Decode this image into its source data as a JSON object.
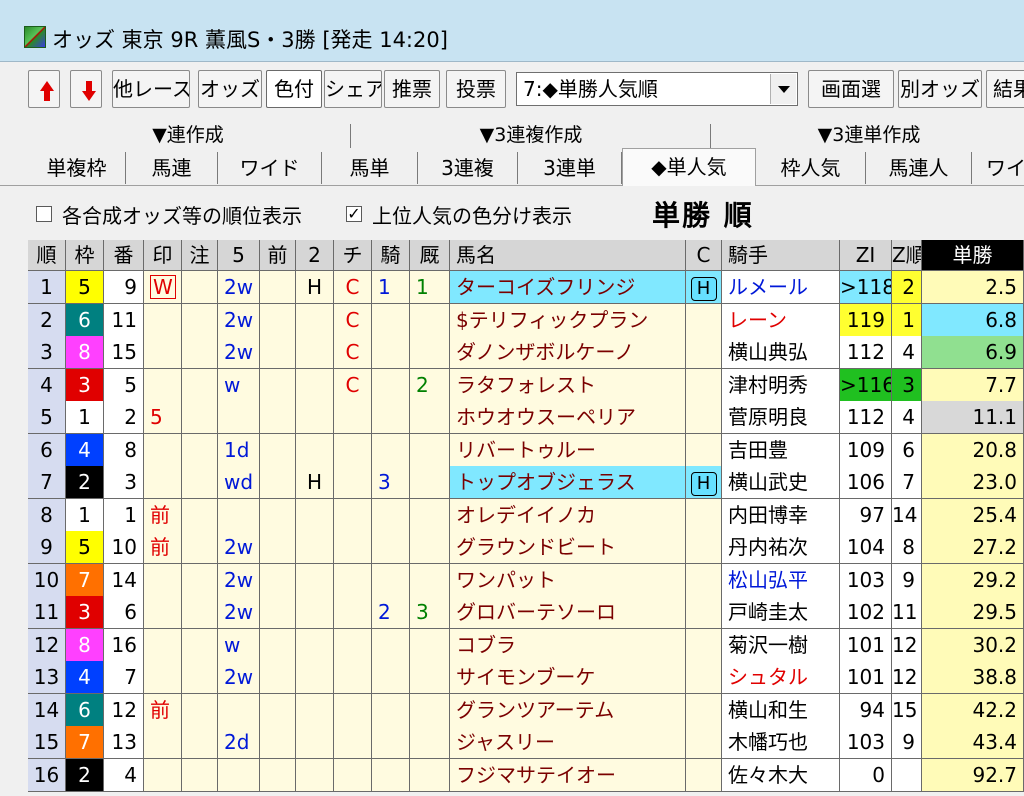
{
  "window": {
    "title": "オッズ 東京 9R 薫風S・3勝 [発走 14:20]"
  },
  "toolbar": {
    "other_race": "他レース",
    "odds": "オッズ",
    "color": "色付",
    "share": "シェア",
    "recommend": "推票",
    "vote": "投票",
    "view_select": "7:◆単勝人気順",
    "screen_select": "画面選",
    "other_odds": "別オッズ",
    "result": "結果"
  },
  "tab_groups": [
    "▼連作成",
    "▼3連複作成",
    "▼3連単作成"
  ],
  "tabs": [
    "単複枠",
    "馬連",
    "ワイド",
    "馬単",
    "3連複",
    "3連単",
    "◆単人気",
    "枠人気",
    "馬連人",
    "ワイ"
  ],
  "options": {
    "rank_display": "各合成オッズ等の順位表示",
    "color_split": "上位人気の色分け表示",
    "heading": "単勝 順"
  },
  "columns": [
    "順",
    "枠",
    "番",
    "印",
    "注",
    "5",
    "前",
    "2",
    "チ",
    "騎",
    "厩",
    "馬名",
    "C",
    "騎手",
    "ZI",
    "Z順",
    "単勝"
  ],
  "colors": {
    "frame": {
      "1": "#ffffff",
      "2": "#000000",
      "3": "#e00000",
      "4": "#0040ff",
      "5": "#ffff00",
      "6": "#008080",
      "7": "#ff7000",
      "8": "#ff40ff"
    },
    "rank_bg": "#d6dcf0",
    "name_highlight": "#80e8ff",
    "zi_yellow": "#ffff30",
    "zi_green": "#20c020",
    "odds_default": "#fffbb8",
    "odds_top1": "#80e8ff",
    "odds_top2": "#90e090",
    "odds_gray": "#d8d8d8"
  },
  "rows": [
    {
      "rank": "1",
      "frame": "5",
      "num": "9",
      "mark": "W",
      "note": "",
      "five": "2w",
      "mae": "",
      "two": "H",
      "chi": "C",
      "ki": "1",
      "kyu": "1",
      "name": "ターコイズフリンジ",
      "c": "H",
      "jockey": "ルメール",
      "jockey_color": "blue",
      "zi": ">118",
      "zrank": "2",
      "odds": "2.5"
    },
    {
      "rank": "2",
      "frame": "6",
      "num": "11",
      "mark": "",
      "note": "",
      "five": "2w",
      "mae": "",
      "two": "",
      "chi": "C",
      "ki": "",
      "kyu": "",
      "name": "$テリフィックプラン",
      "c": "",
      "jockey": "レーン",
      "jockey_color": "red",
      "zi": "119",
      "zrank": "1",
      "odds": "6.8"
    },
    {
      "rank": "3",
      "frame": "8",
      "num": "15",
      "mark": "",
      "note": "",
      "five": "2w",
      "mae": "",
      "two": "",
      "chi": "C",
      "ki": "",
      "kyu": "",
      "name": "ダノンザボルケーノ",
      "c": "",
      "jockey": "横山典弘",
      "jockey_color": "black",
      "zi": "112",
      "zrank": "4",
      "odds": "6.9"
    },
    {
      "rank": "4",
      "frame": "3",
      "num": "5",
      "mark": "",
      "note": "",
      "five": "w",
      "mae": "",
      "two": "",
      "chi": "C",
      "ki": "",
      "kyu": "2",
      "name": "ラタフォレスト",
      "c": "",
      "jockey": "津村明秀",
      "jockey_color": "black",
      "zi": ">116",
      "zrank": "3",
      "odds": "7.7"
    },
    {
      "rank": "5",
      "frame": "1",
      "num": "2",
      "mark": "5",
      "note": "",
      "five": "",
      "mae": "",
      "two": "",
      "chi": "",
      "ki": "",
      "kyu": "",
      "name": "ホウオウスーペリア",
      "c": "",
      "jockey": "菅原明良",
      "jockey_color": "black",
      "zi": "112",
      "zrank": "4",
      "odds": "11.1"
    },
    {
      "rank": "6",
      "frame": "4",
      "num": "8",
      "mark": "",
      "note": "",
      "five": "1d",
      "mae": "",
      "two": "",
      "chi": "",
      "ki": "",
      "kyu": "",
      "name": "リバートゥルー",
      "c": "",
      "jockey": "吉田豊",
      "jockey_color": "black",
      "zi": "109",
      "zrank": "6",
      "odds": "20.8"
    },
    {
      "rank": "7",
      "frame": "2",
      "num": "3",
      "mark": "",
      "note": "",
      "five": "wd",
      "mae": "",
      "two": "H",
      "chi": "",
      "ki": "3",
      "kyu": "",
      "name": "トップオブジェラス",
      "c": "H",
      "jockey": "横山武史",
      "jockey_color": "black",
      "zi": "106",
      "zrank": "7",
      "odds": "23.0"
    },
    {
      "rank": "8",
      "frame": "1",
      "num": "1",
      "mark": "前",
      "note": "",
      "five": "",
      "mae": "",
      "two": "",
      "chi": "",
      "ki": "",
      "kyu": "",
      "name": "オレデイイノカ",
      "c": "",
      "jockey": "内田博幸",
      "jockey_color": "black",
      "zi": "97",
      "zrank": "14",
      "odds": "25.4"
    },
    {
      "rank": "9",
      "frame": "5",
      "num": "10",
      "mark": "前",
      "note": "",
      "five": "2w",
      "mae": "",
      "two": "",
      "chi": "",
      "ki": "",
      "kyu": "",
      "name": "グラウンドビート",
      "c": "",
      "jockey": "丹内祐次",
      "jockey_color": "black",
      "zi": "104",
      "zrank": "8",
      "odds": "27.2"
    },
    {
      "rank": "10",
      "frame": "7",
      "num": "14",
      "mark": "",
      "note": "",
      "five": "2w",
      "mae": "",
      "two": "",
      "chi": "",
      "ki": "",
      "kyu": "",
      "name": "ワンパット",
      "c": "",
      "jockey": "松山弘平",
      "jockey_color": "blue",
      "zi": "103",
      "zrank": "9",
      "odds": "29.2"
    },
    {
      "rank": "11",
      "frame": "3",
      "num": "6",
      "mark": "",
      "note": "",
      "five": "2w",
      "mae": "",
      "two": "",
      "chi": "",
      "ki": "2",
      "kyu": "3",
      "name": "グロバーテソーロ",
      "c": "",
      "jockey": "戸崎圭太",
      "jockey_color": "black",
      "zi": "102",
      "zrank": "11",
      "odds": "29.5"
    },
    {
      "rank": "12",
      "frame": "8",
      "num": "16",
      "mark": "",
      "note": "",
      "five": "w",
      "mae": "",
      "two": "",
      "chi": "",
      "ki": "",
      "kyu": "",
      "name": "コブラ",
      "c": "",
      "jockey": "菊沢一樹",
      "jockey_color": "black",
      "zi": "101",
      "zrank": "12",
      "odds": "30.2"
    },
    {
      "rank": "13",
      "frame": "4",
      "num": "7",
      "mark": "",
      "note": "",
      "five": "2w",
      "mae": "",
      "two": "",
      "chi": "",
      "ki": "",
      "kyu": "",
      "name": "サイモンブーケ",
      "c": "",
      "jockey": "シュタル",
      "jockey_color": "red",
      "zi": "101",
      "zrank": "12",
      "odds": "38.8"
    },
    {
      "rank": "14",
      "frame": "6",
      "num": "12",
      "mark": "前",
      "note": "",
      "five": "",
      "mae": "",
      "two": "",
      "chi": "",
      "ki": "",
      "kyu": "",
      "name": "グランツアーテム",
      "c": "",
      "jockey": "横山和生",
      "jockey_color": "black",
      "zi": "94",
      "zrank": "15",
      "odds": "42.2"
    },
    {
      "rank": "15",
      "frame": "7",
      "num": "13",
      "mark": "",
      "note": "",
      "five": "2d",
      "mae": "",
      "two": "",
      "chi": "",
      "ki": "",
      "kyu": "",
      "name": "ジャスリー",
      "c": "",
      "jockey": "木幡巧也",
      "jockey_color": "black",
      "zi": "103",
      "zrank": "9",
      "odds": "43.4"
    },
    {
      "rank": "16",
      "frame": "2",
      "num": "4",
      "mark": "",
      "note": "",
      "five": "",
      "mae": "",
      "two": "",
      "chi": "",
      "ki": "",
      "kyu": "",
      "name": "フジマサテイオー",
      "c": "",
      "jockey": "佐々木大",
      "jockey_color": "black",
      "zi": "0",
      "zrank": "",
      "odds": "92.7"
    }
  ]
}
